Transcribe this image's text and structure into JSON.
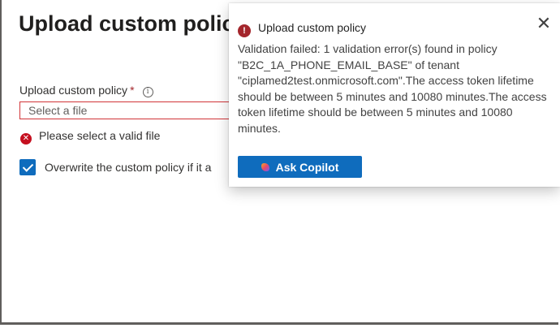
{
  "page": {
    "title": "Upload custom polic",
    "field_label": "Upload custom policy",
    "required_mark": "*",
    "info_icon": "info-icon",
    "file_placeholder": "Select a file",
    "error_text": "Please select a valid file",
    "overwrite_text": "Overwrite the custom policy if it a",
    "overwrite_checked": true
  },
  "toast": {
    "title": "Upload custom policy",
    "status_icon": "error-icon",
    "message": "Validation failed: 1 validation error(s) found in policy \"B2C_1A_PHONE_EMAIL_BASE\" of tenant \"ciplamed2test.onmicrosoft.com\".The access token lifetime should be between 5 minutes and 10080 minutes.The access token lifetime should be between 5 minutes and 10080 minutes.",
    "button_label": "Ask Copilot"
  },
  "colors": {
    "accent": "#0f6cbd",
    "error": "#c50f1f",
    "error_border": "#d13438"
  }
}
